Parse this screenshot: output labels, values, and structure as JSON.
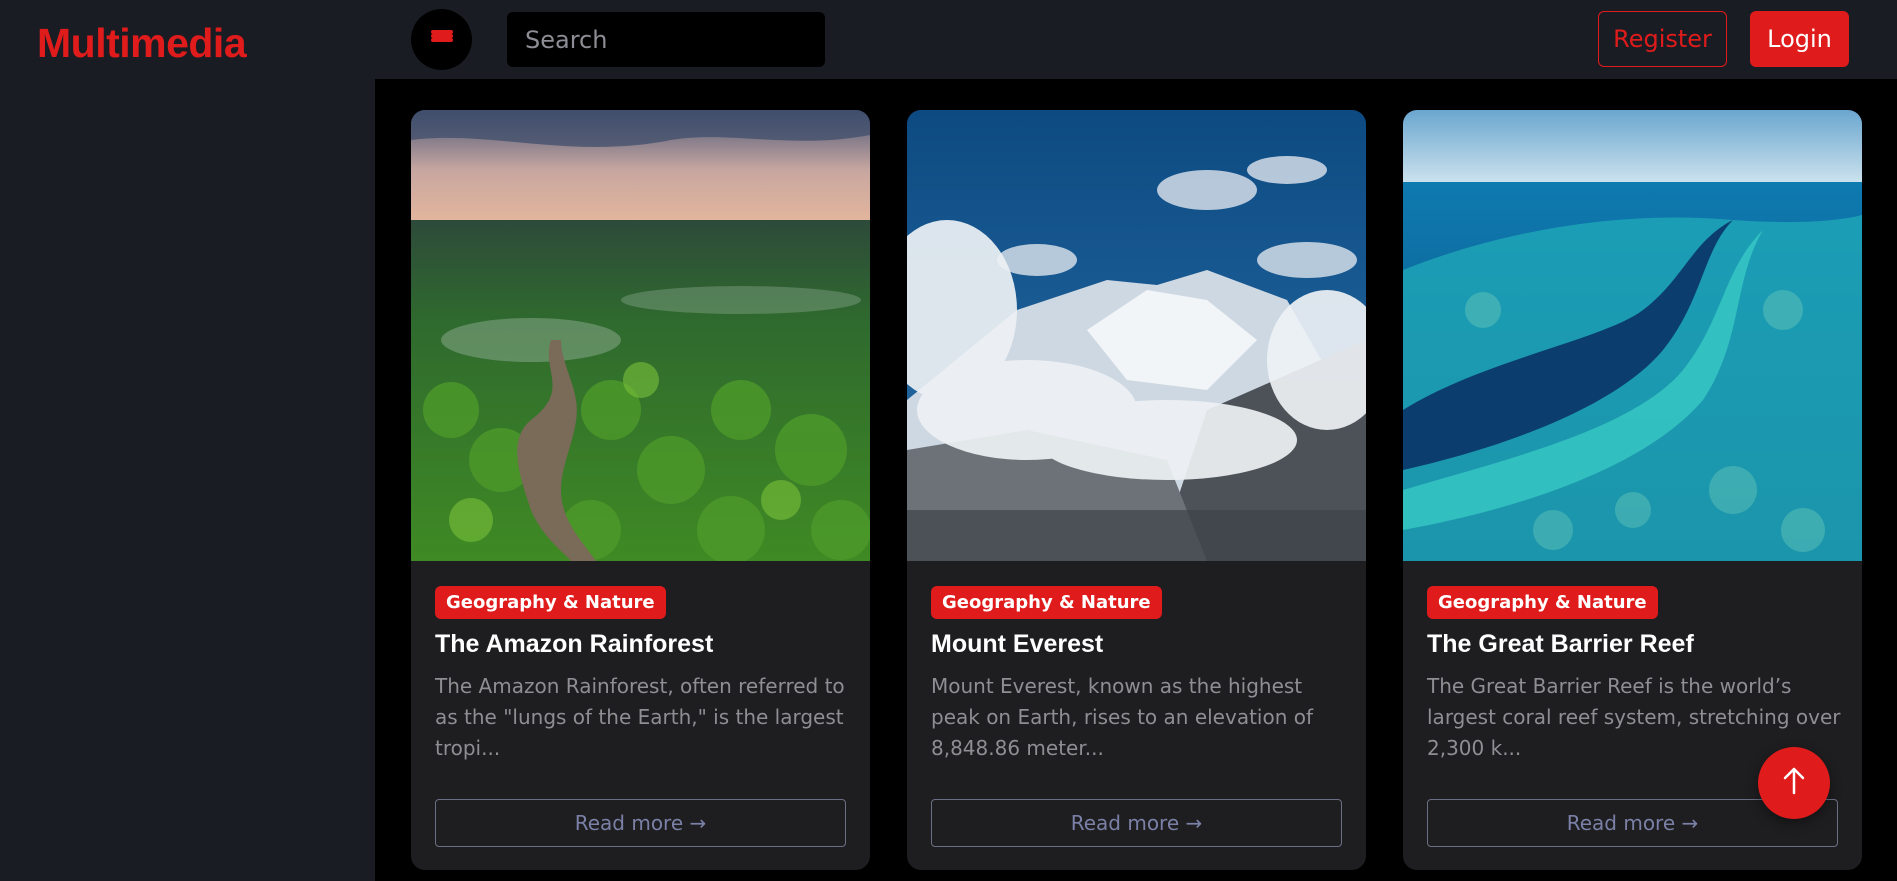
{
  "brand": {
    "name": "Multimedia",
    "color": "#e01b1b"
  },
  "header": {
    "menu_icon": "menu-icon",
    "search_placeholder": "Search",
    "register_label": "Register",
    "login_label": "Login"
  },
  "cards": [
    {
      "tag": "Geography & Nature",
      "title": "The Amazon Rainforest",
      "description": "The Amazon Rainforest, often referred to as the \"lungs of the Earth,\" is the largest tropi...",
      "button": "Read more →",
      "image": "rainforest-aerial-image"
    },
    {
      "tag": "Geography & Nature",
      "title": "Mount Everest",
      "description": "Mount Everest, known as the highest peak on Earth, rises to an elevation of 8,848.86 meter...",
      "button": "Read more →",
      "image": "mountain-peak-image"
    },
    {
      "tag": "Geography & Nature",
      "title": "The Great Barrier Reef",
      "description": "The Great Barrier Reef is the world’s largest coral reef system, stretching over 2,300 k...",
      "button": "Read more →",
      "image": "coral-reef-image"
    }
  ],
  "scroll_top": {
    "icon": "arrow-up-icon"
  }
}
